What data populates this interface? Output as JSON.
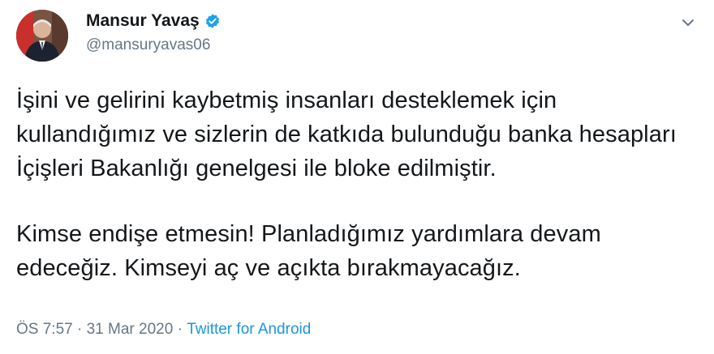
{
  "user": {
    "display_name": "Mansur Yavaş",
    "handle": "@mansuryavas06",
    "verified": true,
    "avatar_icon": "profile-photo-icon"
  },
  "tweet": {
    "paragraphs": [
      "İşini ve gelirini kaybetmiş insanları desteklemek için kullandığımız ve sizlerin de katkıda bulunduğu banka hesapları İçişleri Bakanlığı genelgesi ile bloke edilmiştir.",
      "Kimse endişe etmesin! Planladığımız yardımlara devam edeceğiz. Kimseyi aç ve açıkta bırakmayacağız."
    ],
    "time": "ÖS 7:57",
    "separator": " · ",
    "date": "31 Mar 2020",
    "source": "Twitter for Android"
  },
  "colors": {
    "text": "#14171a",
    "secondary": "#657786",
    "link": "#1b95e0",
    "verified": "#1da1f2"
  }
}
